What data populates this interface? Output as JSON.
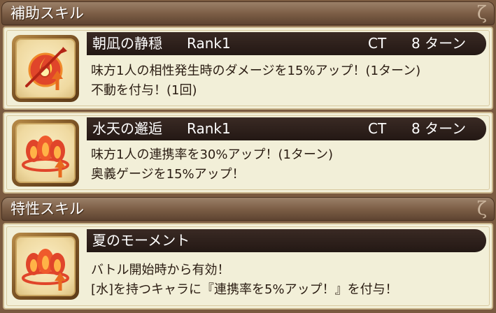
{
  "sections": {
    "support": {
      "title": "補助スキル",
      "curl": "ζ"
    },
    "trait": {
      "title": "特性スキル",
      "curl": "ζ"
    }
  },
  "skills": [
    {
      "name": "朝凪の静穏",
      "rank": "Rank1",
      "ct_label": "CT",
      "ct_value": "8 ターン",
      "icon": "fire-sword-arrow-icon",
      "lines": [
        "味方1人の相性発生時のダメージを15%アップ！(1ターン)",
        "不動を付与！(1回)"
      ]
    },
    {
      "name": "水天の邂逅",
      "rank": "Rank1",
      "ct_label": "CT",
      "ct_value": "8 ターン",
      "icon": "flame-orbs-arrow-icon",
      "lines": [
        "味方1人の連携率を30%アップ！(1ターン)",
        "奥義ゲージを15%アップ！"
      ]
    },
    {
      "name": "夏のモーメント",
      "icon": "flame-orbs-arrow-icon",
      "lines": [
        "バトル開始時から有効！",
        "[水]を持つキャラに『連携率を5%アップ！』を付与！"
      ]
    }
  ],
  "colors": {
    "header": "#7a5c44",
    "card": "#f2efd8",
    "title_bar": "#231814",
    "icon_flame": "#e0452a"
  }
}
